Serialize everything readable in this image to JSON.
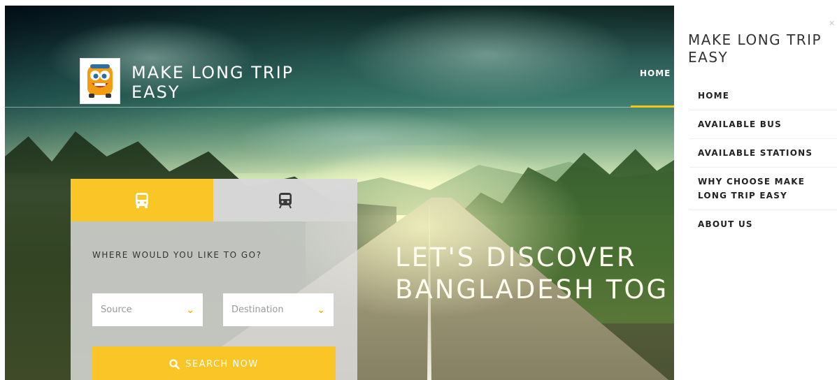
{
  "brand": {
    "title": "MAKE LONG TRIP EASY",
    "logo_icon": "bus-mascot-icon"
  },
  "nav": {
    "home_label": "HOME",
    "active_color": "#f5c518"
  },
  "hero": {
    "headline_line1": "LET'S DISCOVER",
    "headline_line2": "BANGLADESH TOG"
  },
  "search_panel": {
    "tabs": [
      {
        "icon": "bus-icon",
        "active": true
      },
      {
        "icon": "train-icon",
        "active": false
      }
    ],
    "question": "WHERE WOULD YOU LIKE TO GO?",
    "source_placeholder": "Source",
    "destination_placeholder": "Destination",
    "search_button_label": "SEARCH NOW",
    "search_icon": "search-icon",
    "accent_color": "#f9c527"
  },
  "side_menu": {
    "title": "MAKE LONG TRIP EASY",
    "close_icon": "close-icon",
    "items": [
      {
        "label": "HOME"
      },
      {
        "label": "AVAILABLE BUS"
      },
      {
        "label": "AVAILABLE STATIONS"
      },
      {
        "label": "WHY CHOOSE MAKE LONG TRIP EASY"
      },
      {
        "label": "ABOUT US"
      }
    ]
  }
}
